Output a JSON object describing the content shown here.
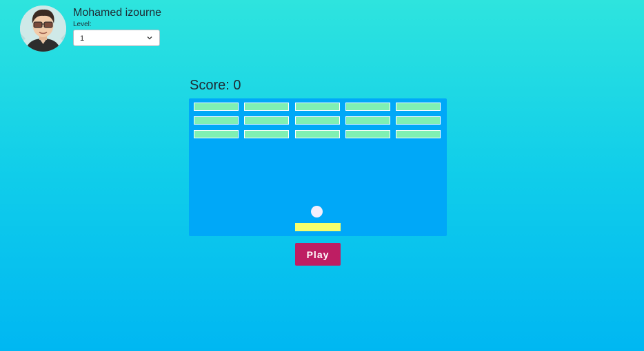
{
  "user": {
    "name": "Mohamed izourne",
    "avatar_icon": "user-avatar-icon"
  },
  "level": {
    "label": "Level:",
    "selected": "1"
  },
  "game": {
    "score_text": "Score: 0",
    "brick_rows": 3,
    "brick_cols": 5,
    "play_label": "Play"
  },
  "colors": {
    "board": "#00a8f8",
    "brick": "#7ff0b3",
    "ball": "#f4eefc",
    "paddle": "#f7ff6c",
    "play_button": "#be1e63"
  }
}
